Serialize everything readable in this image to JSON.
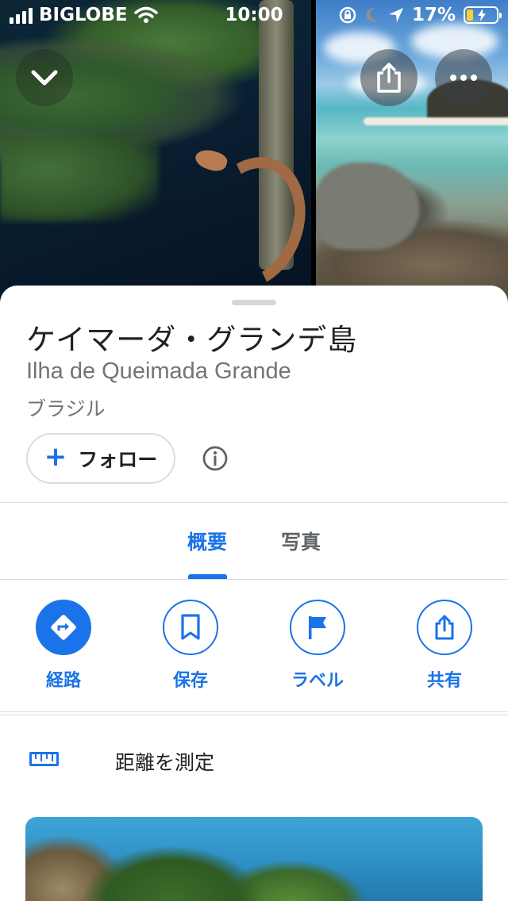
{
  "status_bar": {
    "carrier": "BIGLOBE",
    "time": "10:00",
    "battery_percent": "17%",
    "battery_level": 0.17,
    "icons": [
      "signal-icon",
      "wifi-icon",
      "rotation-lock-icon",
      "moon-icon",
      "location-arrow-icon",
      "battery-charging-icon"
    ]
  },
  "hero": {
    "buttons": [
      "chevron-down-icon",
      "share-icon",
      "more-icon"
    ]
  },
  "place": {
    "title": "ケイマーダ・グランデ島",
    "subtitle": "Ilha de Queimada Grande",
    "country": "ブラジル"
  },
  "follow": {
    "label": "フォロー",
    "plus": "+"
  },
  "tabs": [
    {
      "label": "概要",
      "active": true
    },
    {
      "label": "写真",
      "active": false
    }
  ],
  "actions": [
    {
      "label": "経路",
      "icon": "directions-icon"
    },
    {
      "label": "保存",
      "icon": "bookmark-icon"
    },
    {
      "label": "ラベル",
      "icon": "flag-icon"
    },
    {
      "label": "共有",
      "icon": "share-icon"
    }
  ],
  "measure": {
    "label": "距離を測定",
    "icon": "ruler-icon"
  },
  "colors": {
    "accent": "#1a73e8",
    "text_primary": "#202124",
    "text_secondary": "#70757a",
    "divider": "#dadce0",
    "battery": "#f4d230"
  }
}
